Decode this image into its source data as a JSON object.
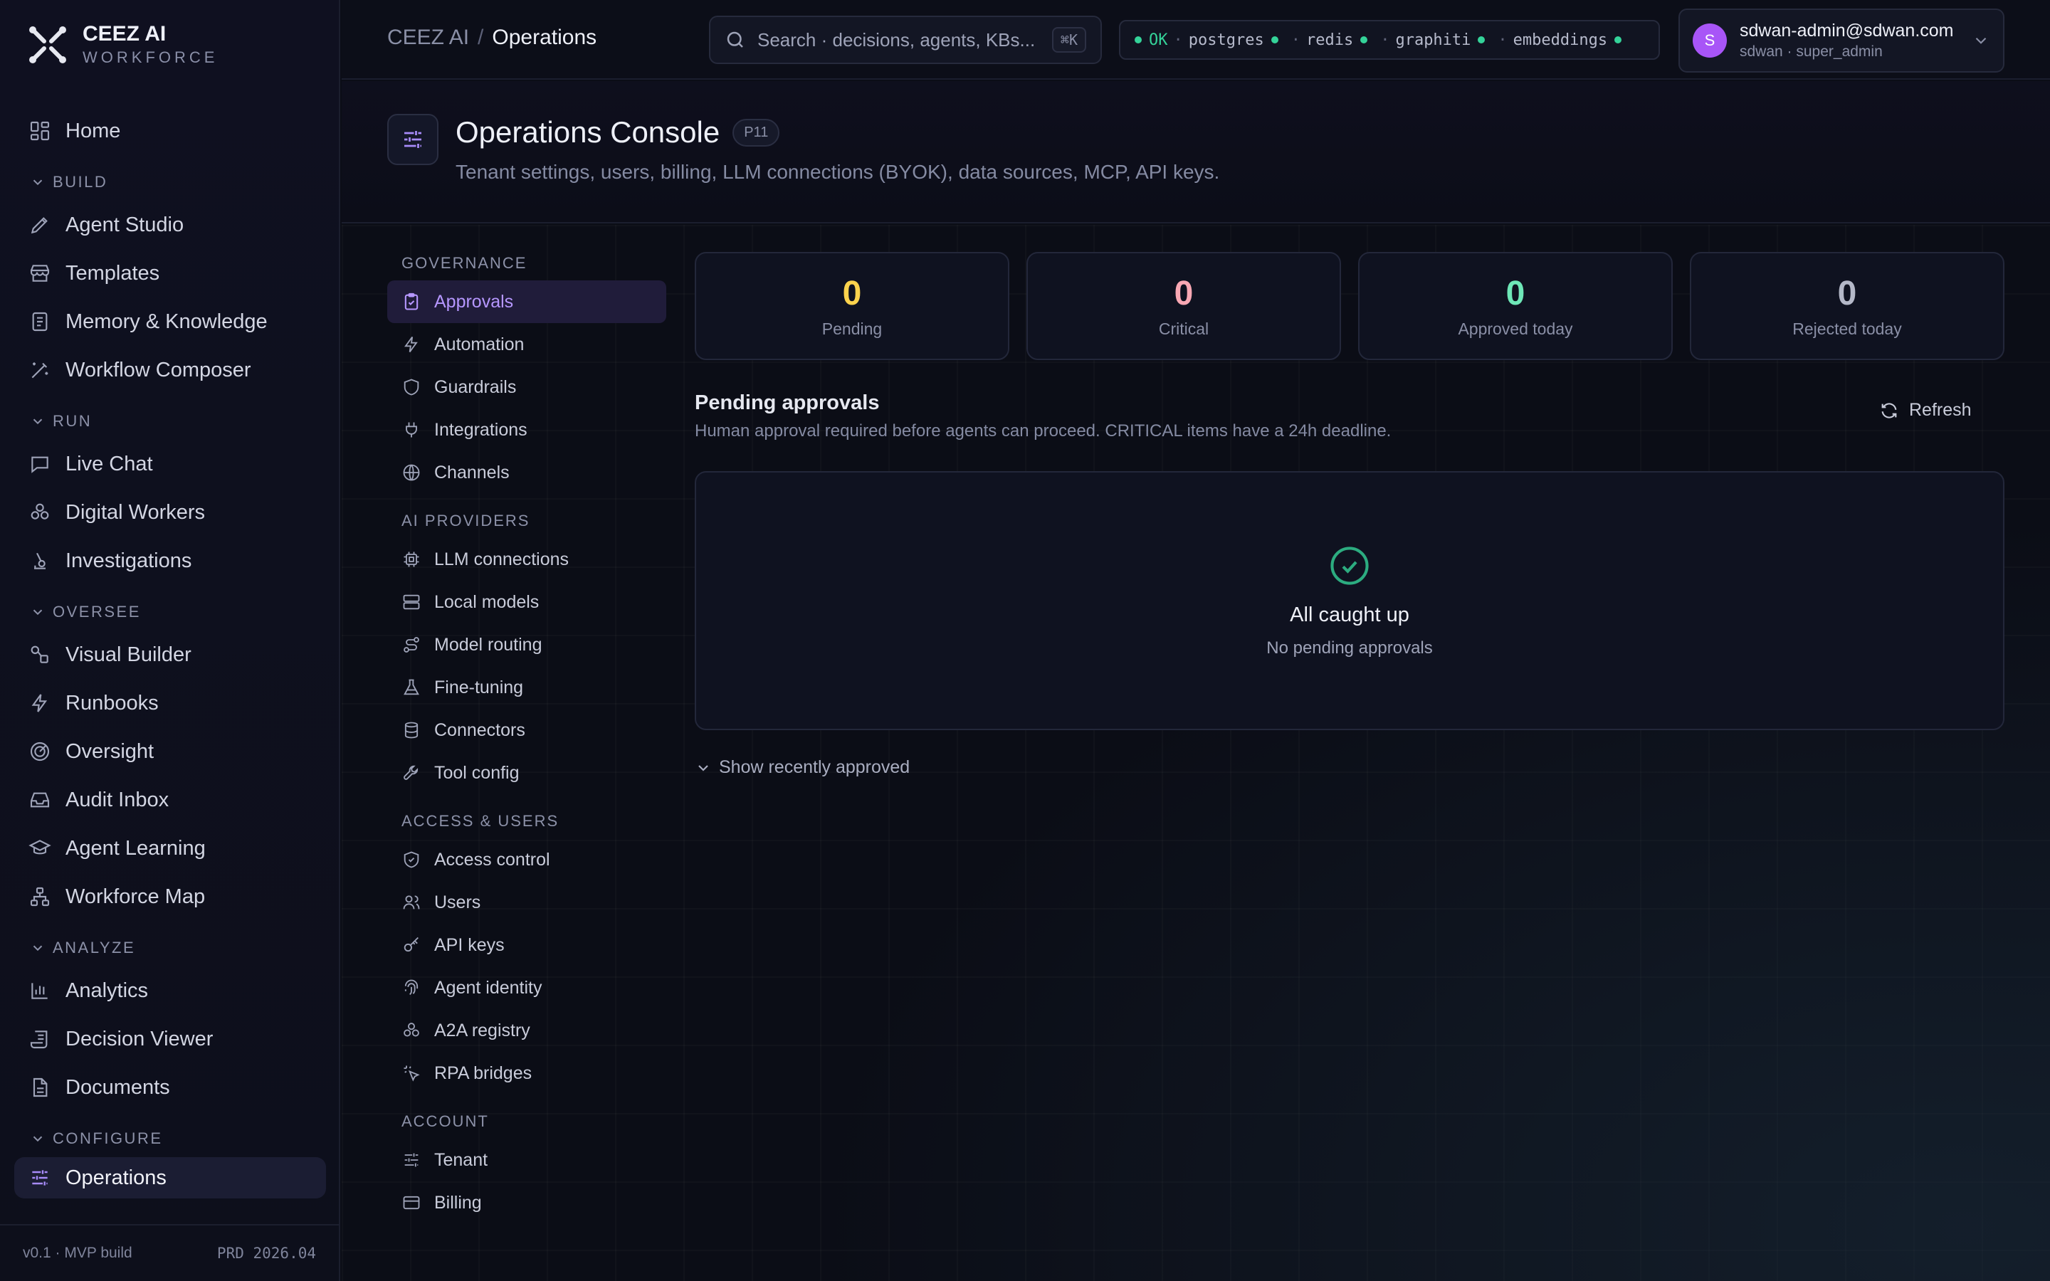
{
  "brand": {
    "name": "CEEZ AI",
    "sub": "WORKFORCE"
  },
  "sidebar": {
    "home": "Home",
    "sections": {
      "build": "BUILD",
      "run": "RUN",
      "oversee": "OVERSEE",
      "analyze": "ANALYZE",
      "configure": "CONFIGURE"
    },
    "items": {
      "agent_studio": "Agent Studio",
      "templates": "Templates",
      "memory": "Memory & Knowledge",
      "workflow": "Workflow Composer",
      "live_chat": "Live Chat",
      "digital_workers": "Digital Workers",
      "investigations": "Investigations",
      "visual_builder": "Visual Builder",
      "runbooks": "Runbooks",
      "oversight": "Oversight",
      "audit_inbox": "Audit Inbox",
      "agent_learning": "Agent Learning",
      "workforce_map": "Workforce Map",
      "analytics": "Analytics",
      "decision_viewer": "Decision Viewer",
      "documents": "Documents",
      "operations": "Operations"
    },
    "footer": {
      "version": "v0.1 · MVP build",
      "build": "PRD 2026.04"
    }
  },
  "topbar": {
    "breadcrumb_root": "CEEZ AI",
    "breadcrumb_sep": "/",
    "breadcrumb_current": "Operations",
    "search_placeholder": "Search · decisions, agents, KBs...",
    "search_shortcut": "⌘K",
    "status": {
      "ok": "OK",
      "services": [
        "postgres",
        "redis",
        "graphiti",
        "embeddings"
      ]
    },
    "user": {
      "initial": "S",
      "email": "sdwan-admin@sdwan.com",
      "role": "sdwan · super_admin"
    }
  },
  "page": {
    "title": "Operations Console",
    "badge": "P11",
    "subtitle": "Tenant settings, users, billing, LLM connections (BYOK), data sources, MCP, API keys."
  },
  "subnav": {
    "governance": "GOVERNANCE",
    "approvals": "Approvals",
    "automation": "Automation",
    "guardrails": "Guardrails",
    "integrations": "Integrations",
    "channels": "Channels",
    "ai_providers": "AI PROVIDERS",
    "llm_connections": "LLM connections",
    "local_models": "Local models",
    "model_routing": "Model routing",
    "fine_tuning": "Fine-tuning",
    "connectors": "Connectors",
    "tool_config": "Tool config",
    "access_users": "ACCESS & USERS",
    "access_control": "Access control",
    "users": "Users",
    "api_keys": "API keys",
    "agent_identity": "Agent identity",
    "a2a_registry": "A2A registry",
    "rpa_bridges": "RPA bridges",
    "account": "ACCOUNT",
    "tenant": "Tenant",
    "billing": "Billing"
  },
  "stats": [
    {
      "value": "0",
      "label": "Pending",
      "color": "#fcd34d"
    },
    {
      "value": "0",
      "label": "Critical",
      "color": "#f9a8b4"
    },
    {
      "value": "0",
      "label": "Approved today",
      "color": "#6ee7b7"
    },
    {
      "value": "0",
      "label": "Rejected today",
      "color": "#b4b8c8"
    }
  ],
  "approvals": {
    "title": "Pending approvals",
    "subtitle": "Human approval required before agents can proceed. CRITICAL items have a 24h deadline.",
    "refresh": "Refresh",
    "empty_title": "All caught up",
    "empty_sub": "No pending approvals",
    "show_recent": "Show recently approved"
  },
  "colors": {
    "accent": "#a78bfa",
    "ok": "#34d399",
    "bg": "#0b0d16"
  }
}
